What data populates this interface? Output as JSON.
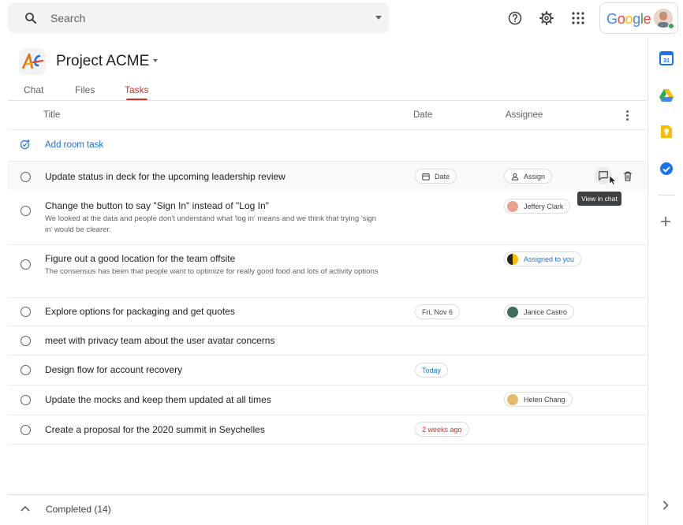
{
  "search": {
    "placeholder": "Search"
  },
  "account": {
    "brand": "Google"
  },
  "room": {
    "title": "Project ACME"
  },
  "tabs": [
    {
      "label": "Chat",
      "active": false
    },
    {
      "label": "Files",
      "active": false
    },
    {
      "label": "Tasks",
      "active": true
    }
  ],
  "columns": {
    "title": "Title",
    "date": "Date",
    "assignee": "Assignee"
  },
  "add_task": {
    "label": "Add room task"
  },
  "tasks": [
    {
      "title": "Update status in deck for the upcoming leadership review",
      "date": "Date",
      "assignee": "Assign",
      "hovered": true
    },
    {
      "title": "Change the button to say \"Sign In\" instead of \"Log In\"",
      "description": "We looked at the data and people don't understand what 'log in' means and we think that trying 'sign in' would be clearer.",
      "assignee": "Jeffery Clark"
    },
    {
      "title": "Figure out a good location for the team offsite",
      "description": "The consensus has been that people want to optimize for really good food and lots of activity options",
      "assignee": "Assigned to you"
    },
    {
      "title": "Explore options for packaging and get quotes",
      "date": "Fri, Nov 6",
      "assignee": "Janice Castro"
    },
    {
      "title": "meet with privacy team about the user avatar concerns"
    },
    {
      "title": "Design flow for account recovery",
      "date": "Today",
      "date_color": "#1a73e8"
    },
    {
      "title": "Update the mocks and keep them updated at all times",
      "assignee": "Helen Chang"
    },
    {
      "title": "Create a proposal for the 2020 summit in Seychelles",
      "date": "2 weeks ago",
      "date_color": "#d93025"
    }
  ],
  "tooltip": {
    "text": "View in chat"
  },
  "completed": {
    "label": "Completed (14)"
  },
  "colors": {
    "accent_blue": "#1a73e8",
    "tab_active": "#d93025",
    "overdue": "#d93025"
  },
  "icons": {
    "top": [
      "help-icon",
      "settings-icon",
      "apps-grid-icon"
    ],
    "rail": [
      "calendar-icon",
      "drive-icon",
      "keep-icon",
      "tasks-icon",
      "add-icon"
    ]
  }
}
